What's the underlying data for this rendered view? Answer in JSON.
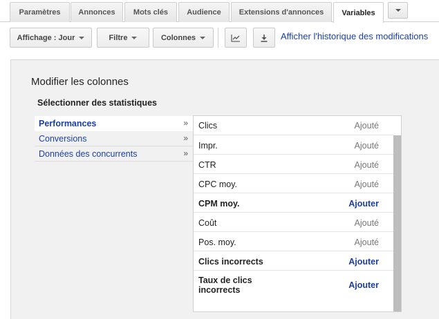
{
  "tabs": [
    {
      "label": "Paramètres",
      "active": false
    },
    {
      "label": "Annonces",
      "active": false
    },
    {
      "label": "Mots clés",
      "active": false
    },
    {
      "label": "Audience",
      "active": false
    },
    {
      "label": "Extensions d'annonces",
      "active": false
    },
    {
      "label": "Variables",
      "active": true
    }
  ],
  "toolbar": {
    "display_label": "Affichage : Jour",
    "filter_label": "Filtre",
    "columns_label": "Colonnes",
    "history_link": "Afficher l'historique des modifications"
  },
  "panel": {
    "title": "Modifier les colonnes",
    "subtitle": "Sélectionner des statistiques",
    "categories": [
      {
        "label": "Performances",
        "active": true,
        "marker": "»"
      },
      {
        "label": "Conversions",
        "active": false,
        "marker": "»"
      },
      {
        "label": "Données des concurrents",
        "active": false,
        "marker": "»"
      }
    ],
    "metrics": [
      {
        "name": "Clics",
        "status": "Ajouté",
        "added": true
      },
      {
        "name": "Impr.",
        "status": "Ajouté",
        "added": true
      },
      {
        "name": "CTR",
        "status": "Ajouté",
        "added": true
      },
      {
        "name": "CPC moy.",
        "status": "Ajouté",
        "added": true
      },
      {
        "name": "CPM moy.",
        "status": "Ajouter",
        "added": false
      },
      {
        "name": "Coût",
        "status": "Ajouté",
        "added": true
      },
      {
        "name": "Pos. moy.",
        "status": "Ajouté",
        "added": true
      },
      {
        "name": "Clics incorrects",
        "status": "Ajouter",
        "added": false
      },
      {
        "name": "Taux de clics incorrects",
        "status": "Ajouter",
        "added": false
      }
    ]
  },
  "colors": {
    "link": "#1a3fa8",
    "panel_bg": "#f1f1f1",
    "added_text": "#777777"
  }
}
